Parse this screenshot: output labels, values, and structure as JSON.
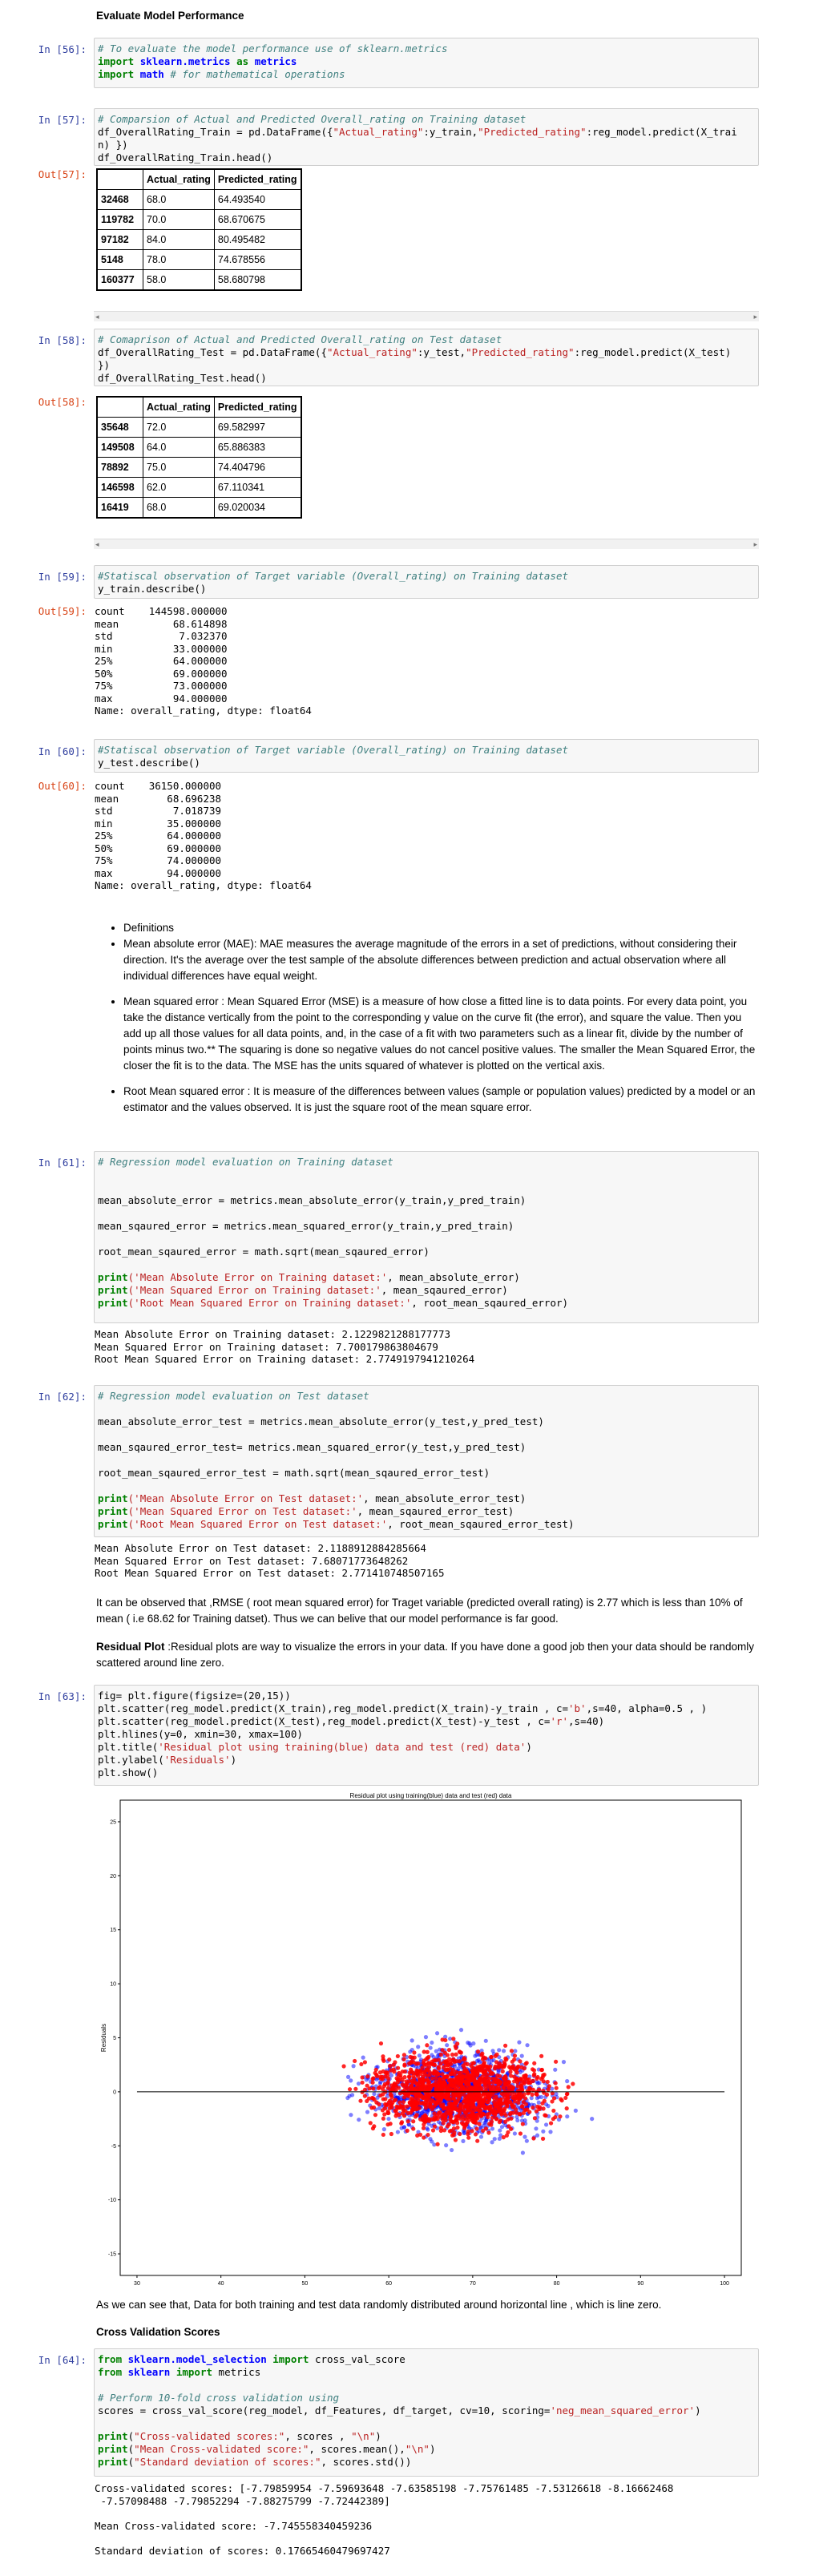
{
  "section_title": "Evaluate Model Performance",
  "cells": {
    "c56": {
      "prompt": "In [56]:",
      "code": [
        [
          [
            "cm",
            "# To evaluate the model performance use of sklearn.metrics"
          ]
        ],
        [
          [
            "kw",
            "import "
          ],
          [
            "nm",
            "sklearn.metrics"
          ],
          [
            "kw",
            " as "
          ],
          [
            "nm",
            "metrics"
          ]
        ],
        [
          [
            "kw",
            "import "
          ],
          [
            "nm",
            "math"
          ],
          [
            "cm",
            " # for mathematical operations"
          ]
        ]
      ]
    },
    "c57": {
      "prompt": "In [57]:",
      "out_prompt": "Out[57]:",
      "code": [
        [
          [
            "cm",
            "# Comparsion of Actual and Predicted Overall_rating on Training dataset"
          ]
        ],
        [
          [
            "",
            "df_OverallRating_Train = pd.DataFrame({"
          ],
          [
            "st",
            "\"Actual_rating\""
          ],
          [
            "",
            ":y_train,"
          ],
          [
            "st",
            "\"Predicted_rating\""
          ],
          [
            "",
            ":reg_model.predict(X_trai"
          ]
        ],
        [
          [
            "",
            "n) })"
          ]
        ],
        [
          [
            "",
            "df_OverallRating_Train.head()"
          ]
        ]
      ],
      "table": {
        "columns": [
          "",
          "Actual_rating",
          "Predicted_rating"
        ],
        "rows": [
          [
            "32468",
            "68.0",
            "64.493540"
          ],
          [
            "119782",
            "70.0",
            "68.670675"
          ],
          [
            "97182",
            "84.0",
            "80.495482"
          ],
          [
            "5148",
            "78.0",
            "74.678556"
          ],
          [
            "160377",
            "58.0",
            "58.680798"
          ]
        ]
      }
    },
    "c58": {
      "prompt": "In [58]:",
      "out_prompt": "Out[58]:",
      "code": [
        [
          [
            "cm",
            "# Comaprison of Actual and Predicted Overall_rating on Test dataset"
          ]
        ],
        [
          [
            "",
            "df_OverallRating_Test = pd.DataFrame({"
          ],
          [
            "st",
            "\"Actual_rating\""
          ],
          [
            "",
            ":y_test,"
          ],
          [
            "st",
            "\"Predicted_rating\""
          ],
          [
            "",
            ":reg_model.predict(X_test)"
          ]
        ],
        [
          [
            "",
            "})"
          ]
        ],
        [
          [
            "",
            "df_OverallRating_Test.head()"
          ]
        ]
      ],
      "table": {
        "columns": [
          "",
          "Actual_rating",
          "Predicted_rating"
        ],
        "rows": [
          [
            "35648",
            "72.0",
            "69.582997"
          ],
          [
            "149508",
            "64.0",
            "65.886383"
          ],
          [
            "78892",
            "75.0",
            "74.404796"
          ],
          [
            "146598",
            "62.0",
            "67.110341"
          ],
          [
            "16419",
            "68.0",
            "69.020034"
          ]
        ]
      }
    },
    "c59": {
      "prompt": "In [59]:",
      "out_prompt": "Out[59]:",
      "code": [
        [
          [
            "cm",
            "#Statiscal observation of Target variable (Overall_rating) on Training dataset"
          ]
        ],
        [
          [
            "",
            "y_train.describe()"
          ]
        ]
      ],
      "output": "count    144598.000000\nmean         68.614898\nstd           7.032370\nmin          33.000000\n25%          64.000000\n50%          69.000000\n75%          73.000000\nmax          94.000000\nName: overall_rating, dtype: float64"
    },
    "c60": {
      "prompt": "In [60]:",
      "out_prompt": "Out[60]:",
      "code": [
        [
          [
            "cm",
            "#Statiscal observation of Target variable (Overall_rating) on Training dataset"
          ]
        ],
        [
          [
            "",
            "y_test.describe()"
          ]
        ]
      ],
      "output": "count    36150.000000\nmean        68.696238\nstd          7.018739\nmin         35.000000\n25%         64.000000\n50%         69.000000\n75%         74.000000\nmax         94.000000\nName: overall_rating, dtype: float64"
    },
    "c61": {
      "prompt": "In [61]:",
      "code": [
        [
          [
            "cm",
            "# Regression model evaluation on Training dataset"
          ]
        ],
        [
          [
            "",
            ""
          ]
        ],
        [
          [
            "",
            ""
          ]
        ],
        [
          [
            "",
            "mean_absolute_error = metrics.mean_absolute_error(y_train,y_pred_train)"
          ]
        ],
        [
          [
            "",
            ""
          ]
        ],
        [
          [
            "",
            "mean_sqaured_error = metrics.mean_squared_error(y_train,y_pred_train)"
          ]
        ],
        [
          [
            "",
            ""
          ]
        ],
        [
          [
            "",
            "root_mean_sqaured_error = math.sqrt(mean_sqaured_error)"
          ]
        ],
        [
          [
            "",
            ""
          ]
        ],
        [
          [
            "kw",
            "print"
          ],
          [
            "",
            ""
          ],
          [
            "st",
            "('Mean Absolute Error on Training dataset:'"
          ],
          [
            "",
            ", mean_absolute_error)"
          ]
        ],
        [
          [
            "kw",
            "print"
          ],
          [
            "st",
            "('Mean Squared Error on Training dataset:'"
          ],
          [
            "",
            ", mean_sqaured_error)"
          ]
        ],
        [
          [
            "kw",
            "print"
          ],
          [
            "st",
            "('Root Mean Squared Error on Training dataset:'"
          ],
          [
            "",
            ", root_mean_sqaured_error)"
          ]
        ]
      ],
      "output": "Mean Absolute Error on Training dataset: 2.1229821288177773\nMean Squared Error on Training dataset: 7.700179863804679\nRoot Mean Squared Error on Training dataset: 2.7749197941210264"
    },
    "c62": {
      "prompt": "In [62]:",
      "code": [
        [
          [
            "cm",
            "# Regression model evaluation on Test dataset"
          ]
        ],
        [
          [
            "",
            ""
          ]
        ],
        [
          [
            "",
            "mean_absolute_error_test = metrics.mean_absolute_error(y_test,y_pred_test)"
          ]
        ],
        [
          [
            "",
            ""
          ]
        ],
        [
          [
            "",
            "mean_sqaured_error_test= metrics.mean_squared_error(y_test,y_pred_test)"
          ]
        ],
        [
          [
            "",
            ""
          ]
        ],
        [
          [
            "",
            "root_mean_sqaured_error_test = math.sqrt(mean_sqaured_error_test)"
          ]
        ],
        [
          [
            "",
            ""
          ]
        ],
        [
          [
            "kw",
            "print"
          ],
          [
            "st",
            "('Mean Absolute Error on Test dataset:'"
          ],
          [
            "",
            ", mean_absolute_error_test)"
          ]
        ],
        [
          [
            "kw",
            "print"
          ],
          [
            "st",
            "('Mean Squared Error on Test dataset:'"
          ],
          [
            "",
            ", mean_sqaured_error_test)"
          ]
        ],
        [
          [
            "kw",
            "print"
          ],
          [
            "st",
            "('Root Mean Squared Error on Test dataset:'"
          ],
          [
            "",
            ", root_mean_sqaured_error_test)"
          ]
        ]
      ],
      "output": "Mean Absolute Error on Test dataset: 2.1188912884285664\nMean Squared Error on Test dataset: 7.68071773648262\nRoot Mean Squared Error on Test dataset: 2.771410748507165"
    },
    "c63": {
      "prompt": "In [63]:",
      "code": [
        [
          [
            "",
            "fig= plt.figure(figsize=(20,15))"
          ]
        ],
        [
          [
            "",
            "plt.scatter(reg_model.predict(X_train),reg_model.predict(X_train)-y_train , c="
          ],
          [
            "st",
            "'b'"
          ],
          [
            "",
            ",s=40, alpha=0.5 , )"
          ]
        ],
        [
          [
            "",
            "plt.scatter(reg_model.predict(X_test),reg_model.predict(X_test)-y_test , c="
          ],
          [
            "st",
            "'r'"
          ],
          [
            "",
            ",s=40)"
          ]
        ],
        [
          [
            "",
            "plt.hlines(y=0, xmin=30, xmax=100)"
          ]
        ],
        [
          [
            "",
            "plt.title("
          ],
          [
            "st",
            "'Residual plot using training(blue) data and test (red) data'"
          ],
          [
            "",
            ")"
          ]
        ],
        [
          [
            "",
            "plt.ylabel("
          ],
          [
            "st",
            "'Residuals'"
          ],
          [
            "",
            ")"
          ]
        ],
        [
          [
            "",
            "plt.show()"
          ]
        ]
      ]
    },
    "c64": {
      "prompt": "In [64]:",
      "code": [
        [
          [
            "kw",
            "from "
          ],
          [
            "nm",
            "sklearn.model_selection"
          ],
          [
            "kw",
            " import "
          ],
          [
            "",
            "cross_val_score"
          ]
        ],
        [
          [
            "kw",
            "from "
          ],
          [
            "nm",
            "sklearn"
          ],
          [
            "kw",
            " import "
          ],
          [
            "",
            "metrics"
          ]
        ],
        [
          [
            "",
            ""
          ]
        ],
        [
          [
            "cm",
            "# Perform 10-fold cross validation using"
          ]
        ],
        [
          [
            "",
            "scores = cross_val_score(reg_model, df_Features, df_target, cv=10, scoring="
          ],
          [
            "st",
            "'neg_mean_squared_error'"
          ],
          [
            "",
            ")"
          ]
        ],
        [
          [
            "",
            ""
          ]
        ],
        [
          [
            "kw",
            "print"
          ],
          [
            "",
            "("
          ],
          [
            "st",
            "\"Cross-validated scores:\""
          ],
          [
            "",
            ", scores , "
          ],
          [
            "st",
            "\"\\n\""
          ],
          [
            "",
            ")"
          ]
        ],
        [
          [
            "kw",
            "print"
          ],
          [
            "",
            "("
          ],
          [
            "st",
            "\"Mean Cross-validated score:\""
          ],
          [
            "",
            ", scores.mean(),"
          ],
          [
            "st",
            "\"\\n\""
          ],
          [
            "",
            ")"
          ]
        ],
        [
          [
            "kw",
            "print"
          ],
          [
            "",
            "("
          ],
          [
            "st",
            "\"Standard deviation of scores:\""
          ],
          [
            "",
            ", scores.std())"
          ]
        ]
      ],
      "output": "Cross-validated scores: [-7.79859954 -7.59693648 -7.63585198 -7.75761485 -7.53126618 -8.16662468\n -7.57098488 -7.79852294 -7.88275799 -7.72442389]\n\nMean Cross-validated score: -7.745558340459236\n\nStandard deviation of scores: 0.17665460479697427"
    }
  },
  "definitions": {
    "title": "Definitions",
    "mae": "Mean absolute error (MAE): MAE measures the average magnitude of the errors in a set of predictions, without considering their direction. It's the average over the test sample of the absolute differences between prediction and actual observation where all individual differences have equal weight.",
    "mse": "Mean squared error : Mean Squared Error (MSE) is a measure of how close a fitted line is to data points. For every data point, you take the distance vertically from the point to the corresponding y value on the curve fit (the error), and square the value. Then you add up all those values for all data points, and, in the case of a fit with two parameters such as a linear fit, divide by the number of points minus two.** The squaring is done so negative values do not cancel positive values. The smaller the Mean Squared Error, the closer the fit is to the data. The MSE has the units squared of whatever is plotted on the vertical axis.",
    "rmse": "Root Mean squared error : It is measure of the differences between values (sample or population values) predicted by a model or an estimator and the values observed. It is just the square root of the mean square error."
  },
  "observation_text": "It can be observed that ,RMSE ( root mean squared error) for Traget variable (predicted overall rating) is 2.77 which is less than 10% of mean ( i.e 68.62 for Training datset). Thus we can belive that our model performance is far good.",
  "residual_plot_label": "Residual Plot",
  "residual_plot_text": " :Residual plots are way to visualize the errors in your data. If you have done a good job then your data should be randomly scattered around line zero.",
  "after_plot_text": "As we can see that, Data for both training and test data randomly distributed around horizontal line , which is line zero.",
  "cv_title": "Cross Validation Scores",
  "colors": {
    "train": "#0000ff",
    "test": "#ff0000",
    "hline": "#000000"
  },
  "chart_data": {
    "type": "scatter",
    "title": "Residual plot using training(blue) data and test (red) data",
    "ylabel": "Residuals",
    "xlim": [
      28,
      102
    ],
    "ylim": [
      -17,
      27
    ],
    "xticks": [
      30,
      40,
      50,
      60,
      70,
      80,
      90,
      100
    ],
    "yticks": [
      -15,
      -10,
      -5,
      0,
      5,
      10,
      15,
      20,
      25
    ],
    "hline": {
      "y": 0,
      "xmin": 30,
      "xmax": 100
    },
    "series": [
      {
        "color": "#0000ff",
        "x_center": 68.6,
        "x_spread": 7.0,
        "y_center": 0,
        "y_spread": 2.8,
        "n": 1400
      },
      {
        "color": "#ff0000",
        "x_center": 68.7,
        "x_spread": 7.0,
        "y_center": 0,
        "y_spread": 2.8,
        "n": 1400
      }
    ],
    "grid": false
  }
}
